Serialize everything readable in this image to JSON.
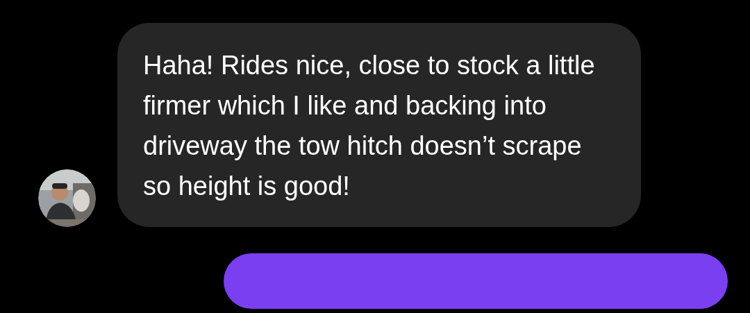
{
  "messages": [
    {
      "kind": "received",
      "text": "Haha! Rides nice, close to stock a little firmer which I like and backing into driveway the tow hitch doesn’t scrape so height is good!"
    },
    {
      "kind": "sent"
    }
  ]
}
